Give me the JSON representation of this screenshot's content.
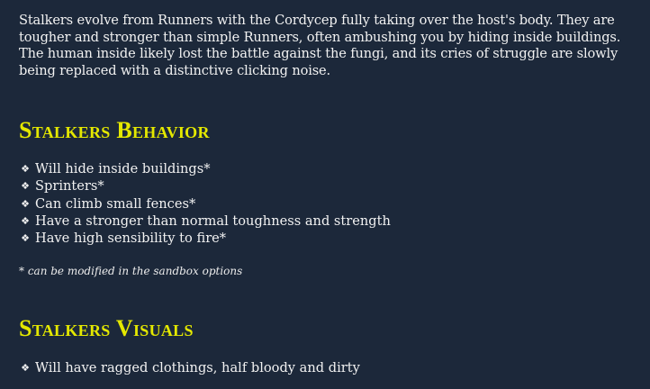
{
  "intro_lines": [
    "Stalkers evolve from Runners with the Cordycep fully taking over the host's body. They are",
    "tougher and stronger than simple Runners, often ambushing you by hiding inside buildings.",
    "The human inside likely lost the battle against the fungi, and its cries of struggle are slowly",
    "being replaced with a distinctive  clicking noise."
  ],
  "behavior": {
    "heading": "Stalkers Behavior",
    "items": [
      "Will hide inside buildings*",
      "Sprinters*",
      "Can climb small fences*",
      "Have a stronger than normal toughness and strength",
      "Have high sensibility to fire*"
    ],
    "note": "* can be modified in the sandbox options"
  },
  "visuals": {
    "heading": "Stalkers Visuals",
    "items": [
      "Will have ragged clothings, half bloody and dirty"
    ]
  },
  "bullet_icon": "❖",
  "colors": {
    "background": "#1c283a",
    "heading": "#e4e800",
    "text": "#f2f2f2"
  }
}
